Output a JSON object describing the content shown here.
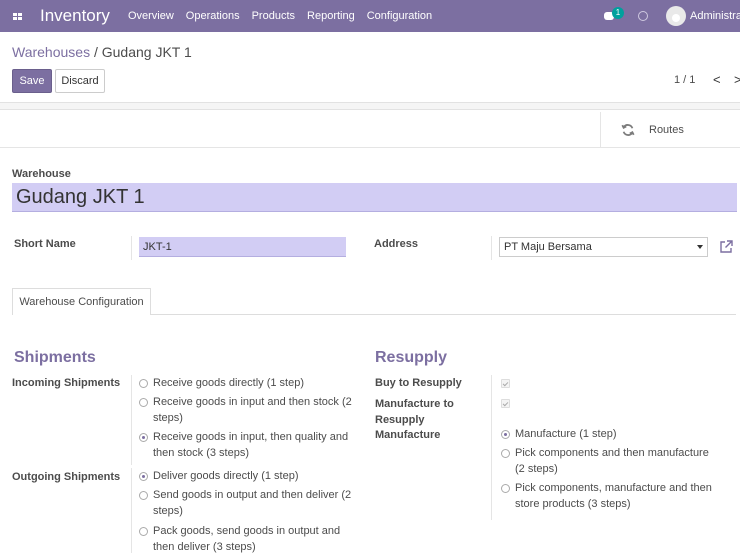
{
  "navbar": {
    "app_name": "Inventory",
    "menu": [
      "Overview",
      "Operations",
      "Products",
      "Reporting",
      "Configuration"
    ],
    "chat_count": "1",
    "user": "Administrator"
  },
  "breadcrumb": {
    "parent": "Warehouses",
    "separator": " / ",
    "current": "Gudang JKT 1"
  },
  "buttons": {
    "save": "Save",
    "discard": "Discard"
  },
  "pager": {
    "value": "1 / 1",
    "prev": "<",
    "next": ">"
  },
  "smart_buttons": {
    "routes": "Routes"
  },
  "form": {
    "warehouse_label": "Warehouse",
    "warehouse_name": "Gudang JKT 1",
    "short_name_label": "Short Name",
    "short_name_value": "JKT-1",
    "address_label": "Address",
    "address_value": "PT Maju Bersama"
  },
  "tabs": {
    "config": "Warehouse Configuration"
  },
  "shipments": {
    "title": "Shipments",
    "incoming_label": "Incoming Shipments",
    "incoming_options": [
      {
        "l1": "Receive goods directly (1 step)",
        "l2": "",
        "checked": false
      },
      {
        "l1": "Receive goods in input and then stock (2",
        "l2": "steps)",
        "checked": false
      },
      {
        "l1": "Receive goods in input, then quality and",
        "l2": "then stock (3 steps)",
        "checked": true
      }
    ],
    "outgoing_label": "Outgoing Shipments",
    "outgoing_options": [
      {
        "l1": "Deliver goods directly (1 step)",
        "l2": "",
        "checked": true
      },
      {
        "l1": "Send goods in output and then deliver (2",
        "l2": "steps)",
        "checked": false
      },
      {
        "l1": "Pack goods, send goods in output and",
        "l2": "then deliver (3 steps)",
        "checked": false
      }
    ]
  },
  "resupply": {
    "title": "Resupply",
    "buy_label": "Buy to Resupply",
    "buy_checked": true,
    "mto_label_1": "Manufacture to",
    "mto_label_2": "Resupply",
    "mto_checked": true,
    "manufacture_label": "Manufacture",
    "manufacture_options": [
      {
        "l1": "Manufacture (1 step)",
        "l2": "",
        "checked": true
      },
      {
        "l1": "Pick components and then manufacture",
        "l2": "(2 steps)",
        "checked": false
      },
      {
        "l1": "Pick components, manufacture and then",
        "l2": "store products (3 steps)",
        "checked": false
      }
    ]
  }
}
